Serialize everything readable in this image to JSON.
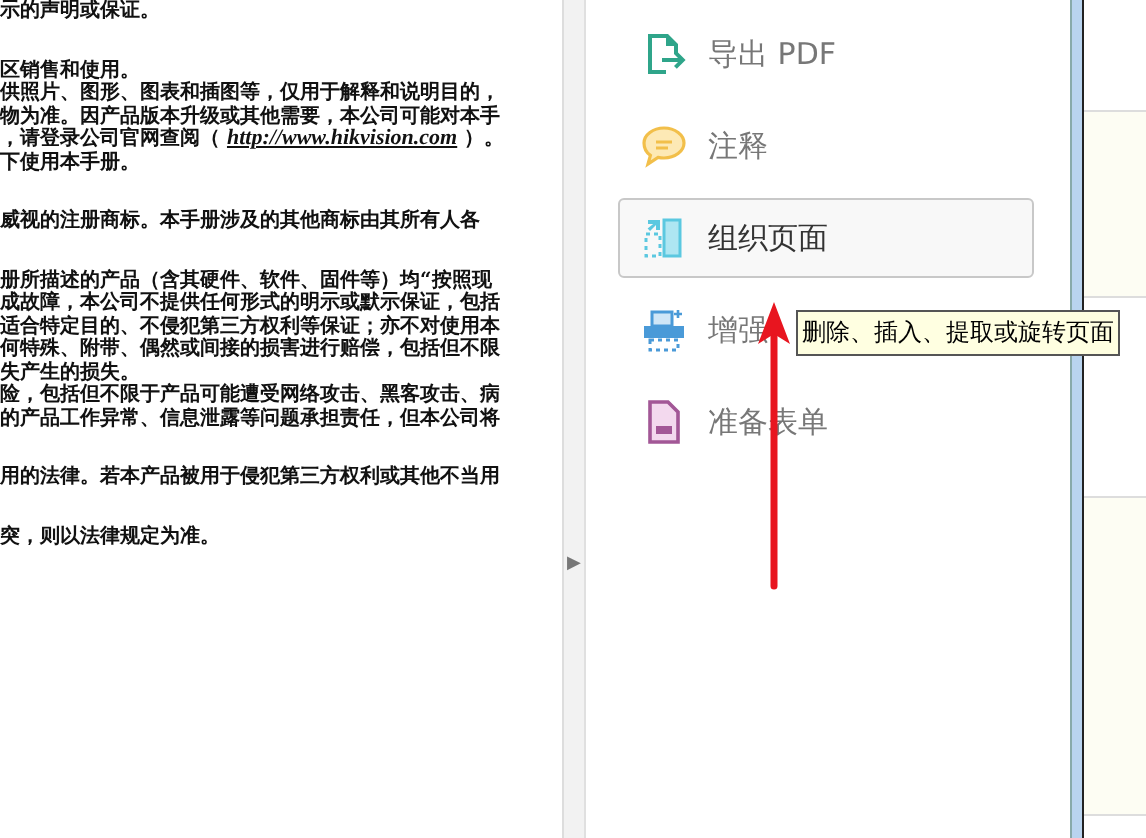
{
  "document": {
    "paragraphs": [
      [
        {
          "kind": "text",
          "text": "示的声明或保证。"
        }
      ],
      [
        {
          "kind": "text",
          "text": "区销售和使用。"
        },
        {
          "kind": "text",
          "text": "供照片、图形、图表和插图等，仅用于解释和说明目的，"
        },
        {
          "kind": "text",
          "text": "物为准。因产品版本升级或其他需要，本公司可能对本手"
        },
        {
          "kind": "link",
          "before": "，请登录公司官网查阅（ ",
          "link": "http://www.hikvision.com",
          "after": " ）。"
        },
        {
          "kind": "text",
          "text": "下使用本手册。"
        }
      ],
      [
        {
          "kind": "text",
          "text": "威视的注册商标。本手册涉及的其他商标由其所有人各"
        }
      ],
      [
        {
          "kind": "text",
          "text": "册所描述的产品（含其硬件、软件、固件等）均“按照现"
        },
        {
          "kind": "text",
          "text": "成故障，本公司不提供任何形式的明示或默示保证，包括"
        },
        {
          "kind": "text",
          "text": "适合特定目的、不侵犯第三方权利等保证；亦不对使用本"
        },
        {
          "kind": "text",
          "text": "何特殊、附带、偶然或间接的损害进行赔偿，包括但不限"
        },
        {
          "kind": "text",
          "text": "失产生的损失。"
        },
        {
          "kind": "text",
          "text": "险，包括但不限于产品可能遭受网络攻击、黑客攻击、病"
        },
        {
          "kind": "text",
          "text": "的产品工作异常、信息泄露等问题承担责任，但本公司将"
        }
      ],
      [
        {
          "kind": "text",
          "text": "用的法律。若本产品被用于侵犯第三方权利或其他不当用"
        }
      ],
      [
        {
          "kind": "text",
          "text": "突，则以法律规定为准。"
        }
      ]
    ]
  },
  "collapse_button": {
    "glyph": "▶"
  },
  "tools": [
    {
      "kind": "export",
      "label": "导出 PDF",
      "selected": false
    },
    {
      "kind": "comment",
      "label": "注释",
      "selected": false
    },
    {
      "kind": "organize",
      "label": "组织页面",
      "selected": true
    },
    {
      "kind": "scan",
      "label": "增强",
      "selected": false
    },
    {
      "kind": "form",
      "label": "准备表单",
      "selected": false
    }
  ],
  "tooltip": {
    "text": "删除、插入、提取或旋转页面"
  }
}
